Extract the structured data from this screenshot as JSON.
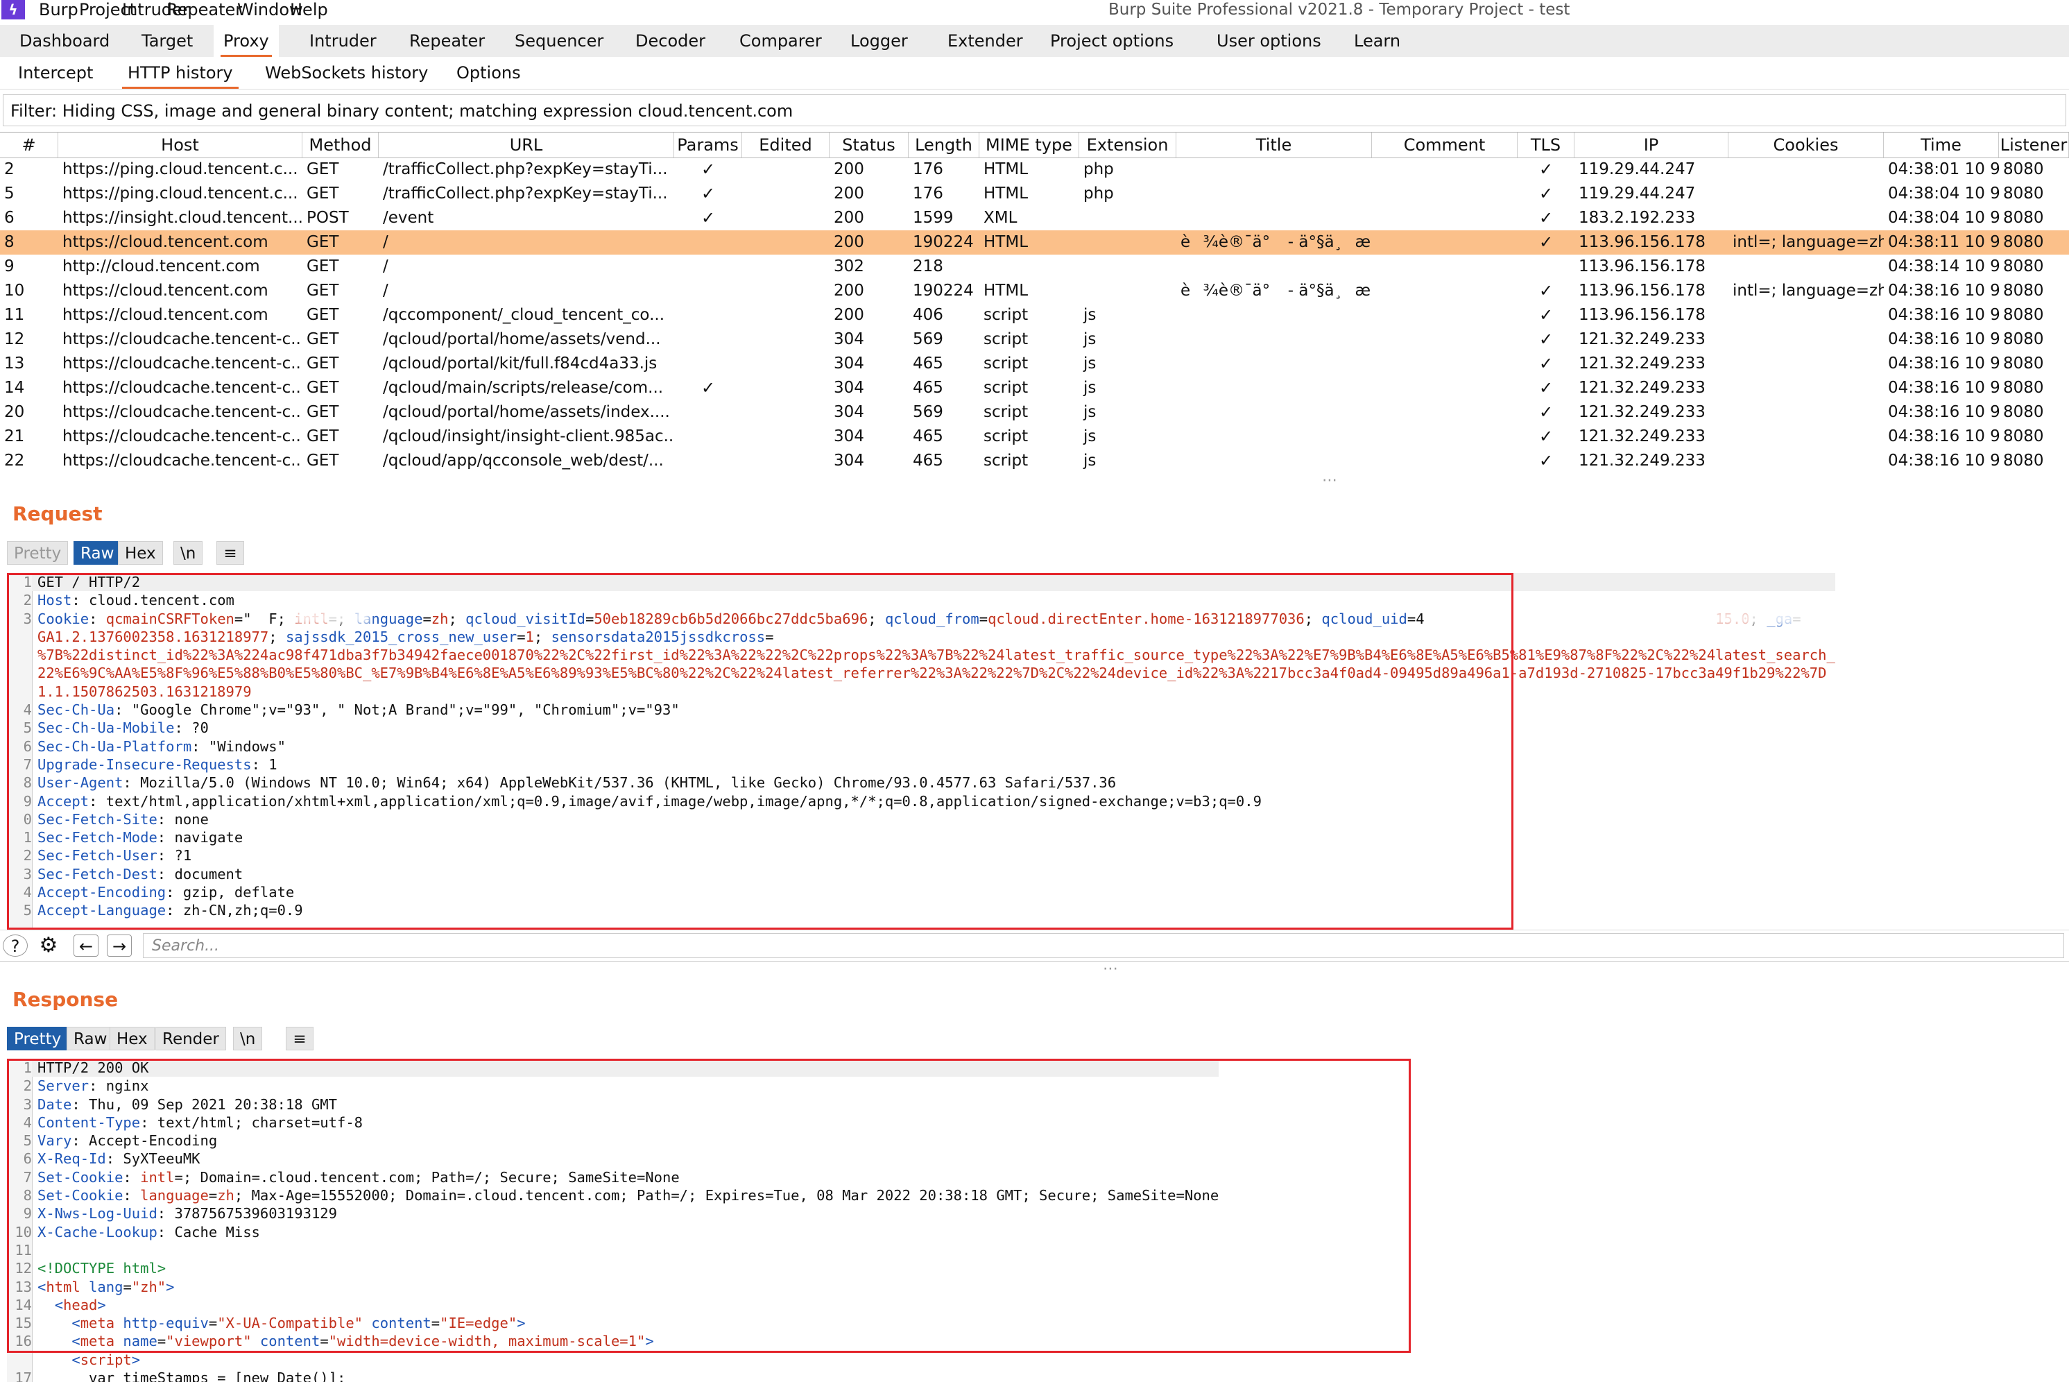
{
  "menu": [
    "Burp",
    "Project",
    "Intruder",
    "Repeater",
    "Window",
    "Help"
  ],
  "window_title": "Burp Suite Professional v2021.8 - Temporary Project - test",
  "main_tabs": [
    "Dashboard",
    "Target",
    "Proxy",
    "Intruder",
    "Repeater",
    "Sequencer",
    "Decoder",
    "Comparer",
    "Logger",
    "Extender",
    "Project options",
    "User options",
    "Learn"
  ],
  "main_tab_active": "Proxy",
  "sub_tabs": [
    "Intercept",
    "HTTP history",
    "WebSockets history",
    "Options"
  ],
  "sub_tab_active": "HTTP history",
  "filter": "Filter: Hiding CSS, image and general binary content;  matching expression cloud.tencent.com",
  "columns": [
    "#",
    "Host",
    "Method",
    "URL",
    "Params",
    "Edited",
    "Status",
    "Length",
    "MIME type",
    "Extension",
    "Title",
    "Comment",
    "TLS",
    "IP",
    "Cookies",
    "Time",
    "Listener"
  ],
  "rows": [
    {
      "n": "2",
      "host": "https://ping.cloud.tencent.c...",
      "method": "GET",
      "url": "/trafficCollect.php?expKey=stayTi...",
      "params": true,
      "status": "200",
      "length": "176",
      "mime": "HTML",
      "ext": "php",
      "title": "",
      "tls": true,
      "ip": "119.29.44.247",
      "cookies": "",
      "time": "04:38:01 10 9...",
      "listener": "8080"
    },
    {
      "n": "5",
      "host": "https://ping.cloud.tencent.c...",
      "method": "GET",
      "url": "/trafficCollect.php?expKey=stayTi...",
      "params": true,
      "status": "200",
      "length": "176",
      "mime": "HTML",
      "ext": "php",
      "title": "",
      "tls": true,
      "ip": "119.29.44.247",
      "cookies": "",
      "time": "04:38:04 10 9...",
      "listener": "8080"
    },
    {
      "n": "6",
      "host": "https://insight.cloud.tencent....",
      "method": "POST",
      "url": "/event",
      "params": true,
      "status": "200",
      "length": "1599",
      "mime": "XML",
      "ext": "",
      "title": "",
      "tls": true,
      "ip": "183.2.192.233",
      "cookies": "",
      "time": "04:38:04 10 9...",
      "listener": "8080"
    },
    {
      "n": "8",
      "host": "https://cloud.tencent.com",
      "method": "GET",
      "url": "/",
      "params": false,
      "status": "200",
      "length": "190224",
      "mime": "HTML",
      "ext": "",
      "title": "è¾è®¯ä° - ä°§ä¸æ...",
      "tls": true,
      "ip": "113.96.156.178",
      "cookies": "intl=; language=zh",
      "time": "04:38:11 10 9...",
      "listener": "8080",
      "selected": true
    },
    {
      "n": "9",
      "host": "http://cloud.tencent.com",
      "method": "GET",
      "url": "/",
      "params": false,
      "status": "302",
      "length": "218",
      "mime": "",
      "ext": "",
      "title": "",
      "tls": false,
      "ip": "113.96.156.178",
      "cookies": "",
      "time": "04:38:14 10 9...",
      "listener": "8080"
    },
    {
      "n": "10",
      "host": "https://cloud.tencent.com",
      "method": "GET",
      "url": "/",
      "params": false,
      "status": "200",
      "length": "190224",
      "mime": "HTML",
      "ext": "",
      "title": "è¾è®¯ä° - ä°§ä¸æ...",
      "tls": true,
      "ip": "113.96.156.178",
      "cookies": "intl=; language=zh",
      "time": "04:38:16 10 9...",
      "listener": "8080"
    },
    {
      "n": "11",
      "host": "https://cloud.tencent.com",
      "method": "GET",
      "url": "/qccomponent/_cloud_tencent_co...",
      "params": false,
      "status": "200",
      "length": "406",
      "mime": "script",
      "ext": "js",
      "title": "",
      "tls": true,
      "ip": "113.96.156.178",
      "cookies": "",
      "time": "04:38:16 10 9...",
      "listener": "8080"
    },
    {
      "n": "12",
      "host": "https://cloudcache.tencent-c...",
      "method": "GET",
      "url": "/qcloud/portal/home/assets/vend...",
      "params": false,
      "status": "304",
      "length": "569",
      "mime": "script",
      "ext": "js",
      "title": "",
      "tls": true,
      "ip": "121.32.249.233",
      "cookies": "",
      "time": "04:38:16 10 9...",
      "listener": "8080"
    },
    {
      "n": "13",
      "host": "https://cloudcache.tencent-c...",
      "method": "GET",
      "url": "/qcloud/portal/kit/full.f84cd4a33.js",
      "params": false,
      "status": "304",
      "length": "465",
      "mime": "script",
      "ext": "js",
      "title": "",
      "tls": true,
      "ip": "121.32.249.233",
      "cookies": "",
      "time": "04:38:16 10 9...",
      "listener": "8080"
    },
    {
      "n": "14",
      "host": "https://cloudcache.tencent-c...",
      "method": "GET",
      "url": "/qcloud/main/scripts/release/com...",
      "params": true,
      "status": "304",
      "length": "465",
      "mime": "script",
      "ext": "js",
      "title": "",
      "tls": true,
      "ip": "121.32.249.233",
      "cookies": "",
      "time": "04:38:16 10 9...",
      "listener": "8080"
    },
    {
      "n": "20",
      "host": "https://cloudcache.tencent-c...",
      "method": "GET",
      "url": "/qcloud/portal/home/assets/index....",
      "params": false,
      "status": "304",
      "length": "569",
      "mime": "script",
      "ext": "js",
      "title": "",
      "tls": true,
      "ip": "121.32.249.233",
      "cookies": "",
      "time": "04:38:16 10 9...",
      "listener": "8080"
    },
    {
      "n": "21",
      "host": "https://cloudcache.tencent-c...",
      "method": "GET",
      "url": "/qcloud/insight/insight-client.985ac...",
      "params": false,
      "status": "304",
      "length": "465",
      "mime": "script",
      "ext": "js",
      "title": "",
      "tls": true,
      "ip": "121.32.249.233",
      "cookies": "",
      "time": "04:38:16 10 9...",
      "listener": "8080"
    },
    {
      "n": "22",
      "host": "https://cloudcache.tencent-c...",
      "method": "GET",
      "url": "/qcloud/app/qcconsole_web/dest/...",
      "params": false,
      "status": "304",
      "length": "465",
      "mime": "script",
      "ext": "js",
      "title": "",
      "tls": true,
      "ip": "121.32.249.233",
      "cookies": "",
      "time": "04:38:16 10 9...",
      "listener": "8080"
    }
  ],
  "request": {
    "title": "Request",
    "view_buttons": [
      "Pretty",
      "Raw",
      "Hex",
      "\\n"
    ],
    "active_view": "Raw",
    "lines": [
      [
        [
          "",
          "GET / HTTP/2"
        ]
      ],
      [
        [
          "k",
          "Host"
        ],
        [
          "",
          ": cloud.tencent.com"
        ]
      ],
      [
        [
          "k",
          "Cookie"
        ],
        [
          "",
          ": "
        ],
        [
          "r",
          "qcmainCSRFToken"
        ],
        [
          "",
          "=\""
        ],
        [
          "",
          "  F; "
        ],
        [
          "r",
          "intl"
        ],
        [
          "",
          "=; "
        ],
        [
          "k",
          "language"
        ],
        [
          "",
          "="
        ],
        [
          "r",
          "zh"
        ],
        [
          "",
          "; "
        ],
        [
          "k",
          "qcloud_visitId"
        ],
        [
          "",
          "="
        ],
        [
          "r",
          "50eb18289cb6b5d2066bc27ddc5ba696"
        ],
        [
          "",
          "; "
        ],
        [
          "k",
          "qcloud_from"
        ],
        [
          "",
          "="
        ],
        [
          "r",
          "qcloud.directEnter.home-16312189770"
        ],
        [
          "r",
          "36"
        ],
        [
          "",
          "; "
        ],
        [
          "k",
          "qcloud_uid"
        ],
        [
          "",
          "="
        ],
        [
          "",
          "4"
        ],
        [
          "",
          "                                  "
        ],
        [
          "r",
          "15.0"
        ],
        [
          "",
          "; "
        ],
        [
          "k",
          "_ga"
        ],
        [
          "",
          "="
        ]
      ],
      [
        [
          "r",
          "GA1.2.1376002358.1631218977"
        ],
        [
          "",
          "; "
        ],
        [
          "k",
          "sajssdk_2015_cross_new_user"
        ],
        [
          "",
          "="
        ],
        [
          "r",
          "1"
        ],
        [
          "",
          "; "
        ],
        [
          "k",
          "sensorsdata2015jssdkcross"
        ],
        [
          "",
          "="
        ]
      ],
      [
        [
          "r",
          "%7B%22distinct_id%22%3A%224ac98f471dba3f7b34942faece001870%22%2C%22first_id%22%3A%22%22%2C%22props%22%3A%7B%22%24latest_traffic_source_type%22%3A%22%E7%9B%B4%E6%8E%A5%E6%B5%81%E9%87%8F%22%2C%22%24latest_search_"
        ]
      ],
      [
        [
          "r",
          "22%E6%9C%AA%E5%8F%96%E5%88%B0%E5%80%BC_%E7%9B%B4%E6%8E%A5%E6%89%93%E5%BC%80%22%2C%22%24latest_referrer%22%3A%22%22%7D%2C%22%24device_id%22%3A%2217bcc3a4f0ad4-09495d89a496a1-a7d193d-2710825-17bcc3a49f1b29%22%7D"
        ]
      ],
      [
        [
          "r",
          "1.1.1507862503.1631218979"
        ]
      ],
      [
        [
          "k",
          "Sec-Ch-Ua"
        ],
        [
          "",
          ": \"Google Chrome\";v=\"93\", \" Not;A Brand\";v=\"99\", \"Chromium\";v=\"93\""
        ]
      ],
      [
        [
          "k",
          "Sec-Ch-Ua-Mobile"
        ],
        [
          "",
          ": ?0"
        ]
      ],
      [
        [
          "k",
          "Sec-Ch-Ua-Platform"
        ],
        [
          "",
          ": \"Windows\""
        ]
      ],
      [
        [
          "k",
          "Upgrade-Insecure-Requests"
        ],
        [
          "",
          ": 1"
        ]
      ],
      [
        [
          "k",
          "User-Agent"
        ],
        [
          "",
          ": Mozilla/5.0 (Windows NT 10.0; Win64; x64) AppleWebKit/537.36 (KHTML, like Gecko) Chrome/93.0.4577.63 Safari/537.36"
        ]
      ],
      [
        [
          "k",
          "Accept"
        ],
        [
          "",
          ": text/html,application/xhtml+xml,application/xml;q=0.9,image/avif,image/webp,image/apng,*/*;q=0.8,application/signed-exchange;v=b3;q=0.9"
        ]
      ],
      [
        [
          "k",
          "Sec-Fetch-Site"
        ],
        [
          "",
          ": none"
        ]
      ],
      [
        [
          "k",
          "Sec-Fetch-Mode"
        ],
        [
          "",
          ": navigate"
        ]
      ],
      [
        [
          "k",
          "Sec-Fetch-User"
        ],
        [
          "",
          ": ?1"
        ]
      ],
      [
        [
          "k",
          "Sec-Fetch-Dest"
        ],
        [
          "",
          ": document"
        ]
      ],
      [
        [
          "k",
          "Accept-Encoding"
        ],
        [
          "",
          ": gzip, deflate"
        ]
      ],
      [
        [
          "k",
          "Accept-Language"
        ],
        [
          "",
          ": zh-CN,zh;q=0.9"
        ]
      ]
    ],
    "gutter": [
      "1",
      "2",
      "3",
      "",
      "",
      "",
      "",
      "4",
      "5",
      "6",
      "7",
      "8",
      "9",
      "0",
      "1",
      "2",
      "3",
      "4",
      "5"
    ],
    "search_placeholder": "Search..."
  },
  "response": {
    "title": "Response",
    "view_buttons": [
      "Pretty",
      "Raw",
      "Hex",
      "Render",
      "\\n"
    ],
    "active_view": "Pretty",
    "lines": [
      [
        [
          "",
          "HTTP/2 200 OK"
        ]
      ],
      [
        [
          "k",
          "Server"
        ],
        [
          "",
          ": nginx"
        ]
      ],
      [
        [
          "k",
          "Date"
        ],
        [
          "",
          ": Thu, 09 Sep 2021 20:38:18 GMT"
        ]
      ],
      [
        [
          "k",
          "Content-Type"
        ],
        [
          "",
          ": text/html; charset=utf-8"
        ]
      ],
      [
        [
          "k",
          "Vary"
        ],
        [
          "",
          ": Accept-Encoding"
        ]
      ],
      [
        [
          "k",
          "X-Req-Id"
        ],
        [
          "",
          ": SyXTeeuMK"
        ]
      ],
      [
        [
          "k",
          "Set-Cookie"
        ],
        [
          "",
          ": "
        ],
        [
          "r",
          "intl"
        ],
        [
          "",
          "=; Domain=.cloud.tencent.com; Path=/; Secure; SameSite=None"
        ]
      ],
      [
        [
          "k",
          "Set-Cookie"
        ],
        [
          "",
          ": "
        ],
        [
          "r",
          "language"
        ],
        [
          "",
          "="
        ],
        [
          "r",
          "zh"
        ],
        [
          "",
          "; Max-Age=15552000; Domain=.cloud.tencent.com; Path=/; Expires=Tue, 08 Mar 2022 20:38:18 GMT; Secure; SameSite=None"
        ]
      ],
      [
        [
          "k",
          "X-Nws-Log-Uuid"
        ],
        [
          "",
          ": 3787567539603193129"
        ]
      ],
      [
        [
          "k",
          "X-Cache-Lookup"
        ],
        [
          "",
          ": Cache Miss"
        ]
      ],
      [
        [
          "",
          ""
        ]
      ],
      [
        [
          "g",
          "<!DOCTYPE html>"
        ]
      ],
      [
        [
          "k",
          "<"
        ],
        [
          "r",
          "html"
        ],
        [
          "",
          ""
        ],
        [
          "k",
          " lang"
        ],
        [
          "",
          "="
        ],
        [
          "r",
          "\"zh\""
        ],
        [
          "k",
          ">"
        ]
      ],
      [
        [
          "",
          ""
        ],
        [
          "",
          "  "
        ],
        [
          "k",
          "<"
        ],
        [
          "r",
          "head"
        ],
        [
          "k",
          ">"
        ]
      ],
      [
        [
          "",
          "    "
        ],
        [
          "k",
          "<"
        ],
        [
          "r",
          "meta"
        ],
        [
          "k",
          " http-equiv"
        ],
        [
          "",
          "="
        ],
        [
          "r",
          "\"X-UA-Compatible\""
        ],
        [
          "k",
          " content"
        ],
        [
          "",
          "="
        ],
        [
          "r",
          "\"IE=edge\""
        ],
        [
          "k",
          ">"
        ]
      ],
      [
        [
          "",
          "    "
        ],
        [
          "k",
          "<"
        ],
        [
          "r",
          "meta"
        ],
        [
          "k",
          " name"
        ],
        [
          "",
          "="
        ],
        [
          "r",
          "\"viewport\""
        ],
        [
          "k",
          " content"
        ],
        [
          "",
          "="
        ],
        [
          "r",
          "\"width=device-width, maximum-scale=1\""
        ],
        [
          "k",
          ">"
        ]
      ],
      [
        [
          "",
          "    "
        ],
        [
          "k",
          "<"
        ],
        [
          "r",
          "script"
        ],
        [
          "k",
          ">"
        ]
      ],
      [
        [
          "",
          "      var timeStamps = [new Date()];"
        ]
      ]
    ],
    "gutter": [
      "1",
      "2",
      "3",
      "4",
      "5",
      "6",
      "7",
      "8",
      "9",
      "10",
      "11",
      "12",
      "13",
      "14",
      "15",
      "16",
      "",
      "17"
    ]
  }
}
